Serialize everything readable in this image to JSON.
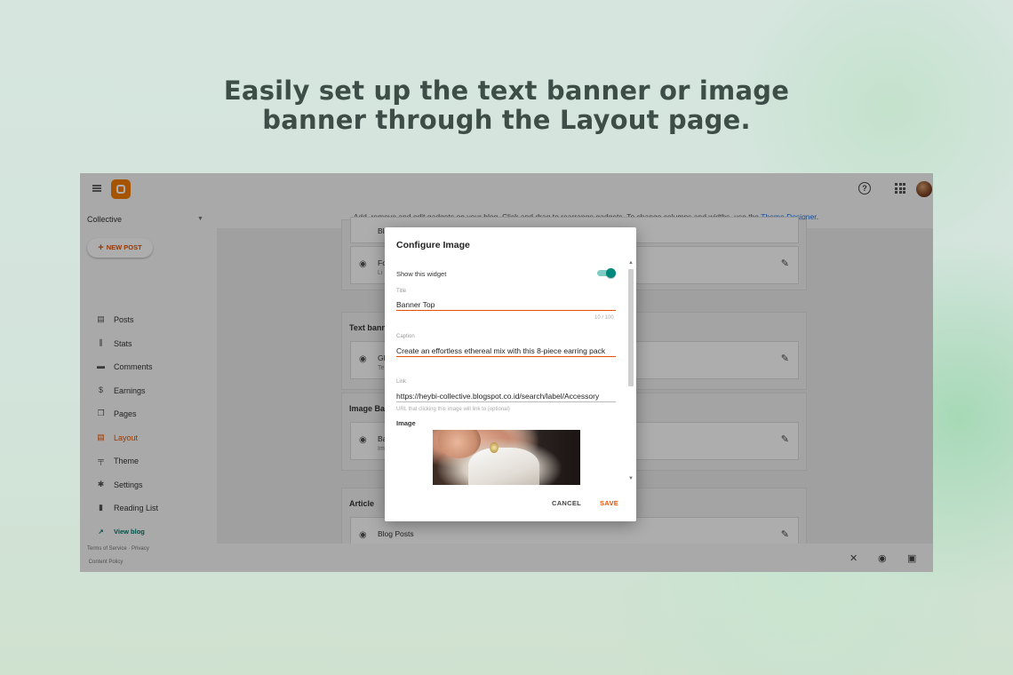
{
  "headline": {
    "line1": "Easily set up the text banner or image",
    "line2": "banner through the Layout page."
  },
  "app": {
    "blog_name": "Collective",
    "new_post_label": "NEW POST",
    "nav": [
      {
        "label": "Posts",
        "icon": "posts-icon"
      },
      {
        "label": "Stats",
        "icon": "stats-icon"
      },
      {
        "label": "Comments",
        "icon": "comments-icon"
      },
      {
        "label": "Earnings",
        "icon": "dollar-icon"
      },
      {
        "label": "Pages",
        "icon": "pages-icon"
      },
      {
        "label": "Layout",
        "icon": "layout-icon",
        "active": true
      },
      {
        "label": "Theme",
        "icon": "theme-icon"
      },
      {
        "label": "Settings",
        "icon": "gear-icon"
      },
      {
        "label": "Reading List",
        "icon": "bookmark-icon"
      },
      {
        "label": "View blog",
        "icon": "external-link-icon"
      }
    ],
    "footer": {
      "terms": "Terms of Service",
      "sep": "·",
      "privacy": "Privacy",
      "content_policy": "Content Policy"
    },
    "info_bar": {
      "text": "Add, remove and edit gadgets on your blog. Click and drag to rearrange gadgets. To change columns and widths, use the ",
      "link": "Theme Designer",
      "end": "."
    },
    "sections": [
      {
        "title": "",
        "gadgets": [
          {
            "name": "Bl",
            "sub": ""
          },
          {
            "name": "Fo",
            "sub": "Li"
          }
        ]
      },
      {
        "title": "Text bann",
        "gadgets": [
          {
            "name": "Gl",
            "sub": "Te"
          }
        ]
      },
      {
        "title": "Image Ba",
        "gadgets": [
          {
            "name": "Ba",
            "sub": "Im"
          }
        ]
      },
      {
        "title": "Article",
        "gadgets": [
          {
            "name": "Blog Posts",
            "sub": ""
          }
        ]
      }
    ],
    "accent": "#e65100",
    "teal": "#00796b"
  },
  "dialog": {
    "title": "Configure Image",
    "show_widget_label": "Show this widget",
    "show_widget_on": true,
    "title_field": {
      "label": "Title",
      "value": "Banner Top",
      "counter": "10 / 100"
    },
    "caption_field": {
      "label": "Caption",
      "value": "Create an effortless ethereal mix with this 8-piece earring pack"
    },
    "link_field": {
      "label": "Link",
      "value": "https://heybi-collective.blogspot.co.id/search/label/Accessory",
      "hint": "URL that clicking this image will link to (optional)"
    },
    "image_label": "Image",
    "cancel_label": "CANCEL",
    "save_label": "SAVE"
  }
}
